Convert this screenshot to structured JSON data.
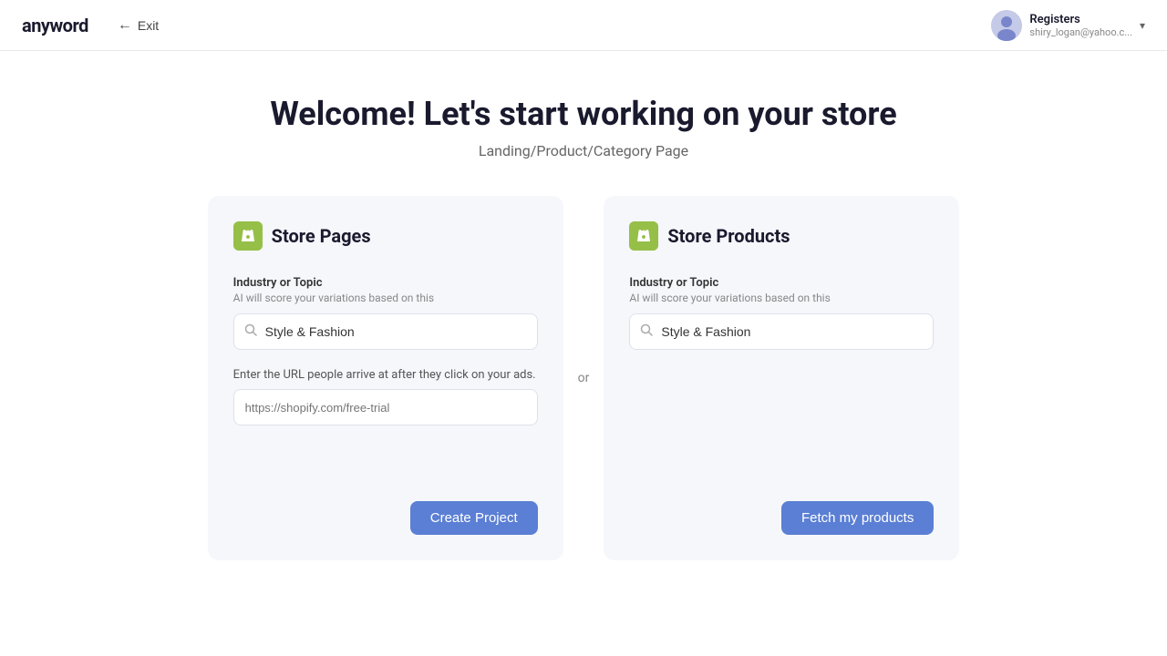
{
  "header": {
    "logo": "anyword",
    "exit_label": "Exit",
    "user": {
      "name": "Registers",
      "email": "shiry_logan@yahoo.c..."
    }
  },
  "main": {
    "title": "Welcome! Let's start working on your store",
    "subtitle": "Landing/Product/Category Page",
    "or_label": "or"
  },
  "store_pages_card": {
    "title": "Store Pages",
    "industry_label": "Industry or Topic",
    "industry_hint": "AI will score your variations based on this",
    "industry_value": "Style & Fashion",
    "url_label": "Enter the URL people arrive at after they click on your ads.",
    "url_placeholder": "https://shopify.com/free-trial",
    "button_label": "Create Project"
  },
  "store_products_card": {
    "title": "Store Products",
    "industry_label": "Industry or Topic",
    "industry_hint": "AI will score your variations based on this",
    "industry_value": "Style & Fashion",
    "button_label": "Fetch my products"
  },
  "icons": {
    "search": "🔍",
    "exit_arrow": "←",
    "chevron_down": "▾"
  }
}
